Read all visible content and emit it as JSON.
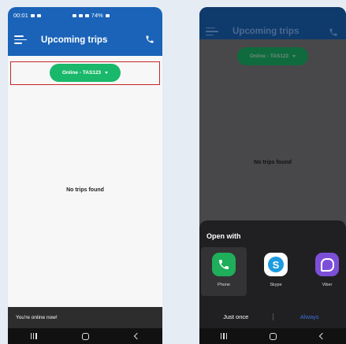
{
  "left": {
    "status": {
      "time": "00:01",
      "battery": "74%"
    },
    "title": "Upcoming trips",
    "status_button": "Online - TAS123",
    "empty_message": "No trips found",
    "snackbar": "You're online now!"
  },
  "right": {
    "title": "Upcoming trips",
    "status_button": "Online - TAS123",
    "empty_message": "No trips found",
    "sheet": {
      "title": "Open with",
      "apps": [
        {
          "label": "Phone",
          "icon": "phone-app-icon",
          "color": "#1fae5a"
        },
        {
          "label": "Skype",
          "icon": "skype-icon",
          "color": "#ffffff"
        },
        {
          "label": "Viber",
          "icon": "viber-icon",
          "color": "#7d4fd8"
        }
      ],
      "just_once": "Just once",
      "always": "Always"
    }
  },
  "colors": {
    "app_bar": "#1a63b8",
    "online_pill": "#19b86a",
    "highlight": "#c0262a",
    "always": "#3b6fd8"
  }
}
